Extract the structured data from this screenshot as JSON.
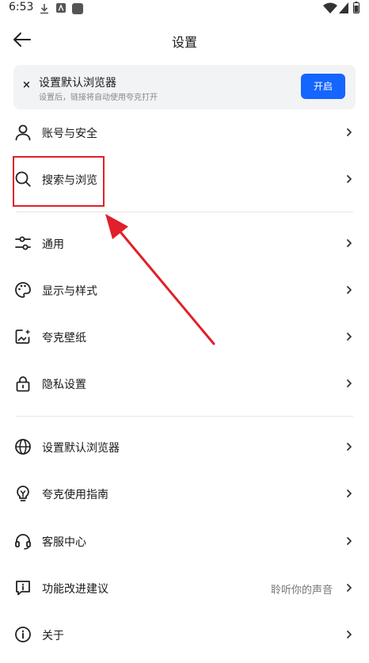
{
  "status_bar": {
    "time": "6:53"
  },
  "header": {
    "title": "设置"
  },
  "banner": {
    "close": "×",
    "title": "设置默认浏览器",
    "subtitle": "设置后，链接将自动使用夸克打开",
    "button": "开启"
  },
  "items": [
    {
      "label": "账号与安全"
    },
    {
      "label": "搜索与浏览"
    },
    {
      "label": "通用"
    },
    {
      "label": "显示与样式"
    },
    {
      "label": "夸克壁纸"
    },
    {
      "label": "隐私设置"
    },
    {
      "label": "设置默认浏览器"
    },
    {
      "label": "夸克使用指南"
    },
    {
      "label": "客服中心"
    },
    {
      "label": "功能改进建议",
      "value": "聆听你的声音"
    },
    {
      "label": "关于"
    }
  ],
  "colors": {
    "accent": "#1565ff",
    "annotation": "#e0202a"
  }
}
